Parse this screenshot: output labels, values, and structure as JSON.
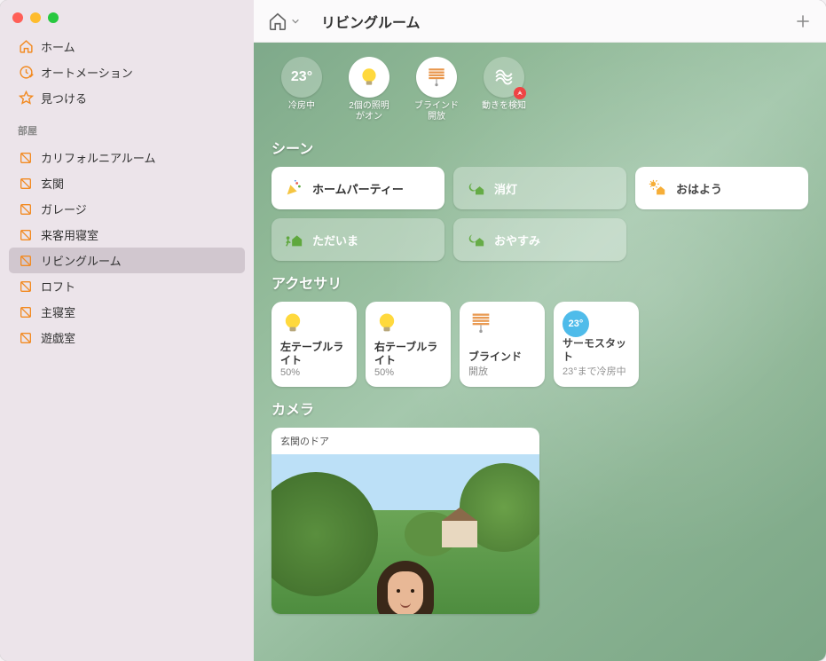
{
  "sidebar": {
    "top": [
      {
        "label": "ホーム",
        "icon": "house"
      },
      {
        "label": "オートメーション",
        "icon": "clock-check"
      },
      {
        "label": "見つける",
        "icon": "star"
      }
    ],
    "rooms_header": "部屋",
    "rooms": [
      {
        "label": "カリフォルニアルーム"
      },
      {
        "label": "玄関"
      },
      {
        "label": "ガレージ"
      },
      {
        "label": "来客用寝室"
      },
      {
        "label": "リビングルーム",
        "selected": true
      },
      {
        "label": "ロフト"
      },
      {
        "label": "主寝室"
      },
      {
        "label": "遊戯室"
      }
    ]
  },
  "toolbar": {
    "title": "リビングルーム"
  },
  "status": [
    {
      "value": "23°",
      "label": "冷房中",
      "badge": "blue",
      "translucent": true
    },
    {
      "icon": "bulb",
      "label": "2個の照明\nがオン"
    },
    {
      "icon": "blinds",
      "label": "ブラインド\n開放"
    },
    {
      "icon": "motion",
      "label": "動きを検知",
      "badge": "red",
      "translucent": true
    }
  ],
  "sections": {
    "scenes": "シーン",
    "accessories": "アクセサリ",
    "cameras": "カメラ"
  },
  "scenes": [
    {
      "label": "ホームパーティー",
      "icon": "party",
      "active": true
    },
    {
      "label": "消灯",
      "icon": "moon-house",
      "active": false
    },
    {
      "label": "おはよう",
      "icon": "sun-house",
      "active": true
    },
    {
      "label": "ただいま",
      "icon": "arrive",
      "active": false
    },
    {
      "label": "おやすみ",
      "icon": "moon-house",
      "active": false
    }
  ],
  "accessories": [
    {
      "name": "左テーブルライト",
      "status": "50%",
      "icon": "bulb"
    },
    {
      "name": "右テーブルライト",
      "status": "50%",
      "icon": "bulb"
    },
    {
      "name": "ブラインド",
      "status": "開放",
      "icon": "blinds"
    },
    {
      "name": "サーモスタット",
      "status": "23°まで冷房中",
      "icon": "thermostat",
      "badge": "23°"
    }
  ],
  "camera": {
    "name": "玄関のドア"
  }
}
